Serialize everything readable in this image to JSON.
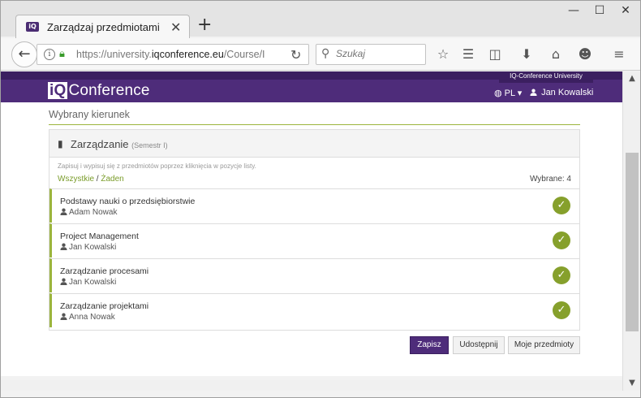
{
  "browser": {
    "tab_title": "Zarządzaj przedmiotami",
    "tab_favicon_text": "iQ",
    "new_tab_symbol": "+",
    "url_prefix": "https://university.",
    "url_domain": "iqconference.eu",
    "url_path": "/Course/I",
    "search_placeholder": "Szukaj",
    "window_controls": {
      "minimize": "—",
      "maximize": "☐",
      "close": "✕"
    }
  },
  "site": {
    "logo_iq": "iQ",
    "logo_text": "Conference",
    "university_badge": "IQ-Conference University",
    "language": "PL",
    "user_name": "Jan Kowalski"
  },
  "content": {
    "section_title": "Wybrany kierunek",
    "panel": {
      "title": "Zarządzanie",
      "subtitle": "(Semestr I)",
      "hint": "Zapisuj i wypisuj się z przedmiotów poprzez kliknięcia w pozycje listy.",
      "select_all": "Wszystkie",
      "separator": "/",
      "select_none": "Żaden",
      "selected_label": "Wybrane: 4"
    },
    "courses": [
      {
        "name": "Podstawy nauki o przedsiębiorstwie",
        "teacher": "Adam Nowak",
        "selected": true
      },
      {
        "name": "Project Management",
        "teacher": "Jan Kowalski",
        "selected": true
      },
      {
        "name": "Zarządzanie procesami",
        "teacher": "Jan Kowalski",
        "selected": true
      },
      {
        "name": "Zarządzanie projektami",
        "teacher": "Anna Nowak",
        "selected": true
      }
    ],
    "buttons": {
      "save": "Zapisz",
      "share": "Udostępnij",
      "my_courses": "Moje przedmioty"
    }
  },
  "colors": {
    "brand_purple": "#4e2c7a",
    "accent_green": "#86a02c"
  }
}
